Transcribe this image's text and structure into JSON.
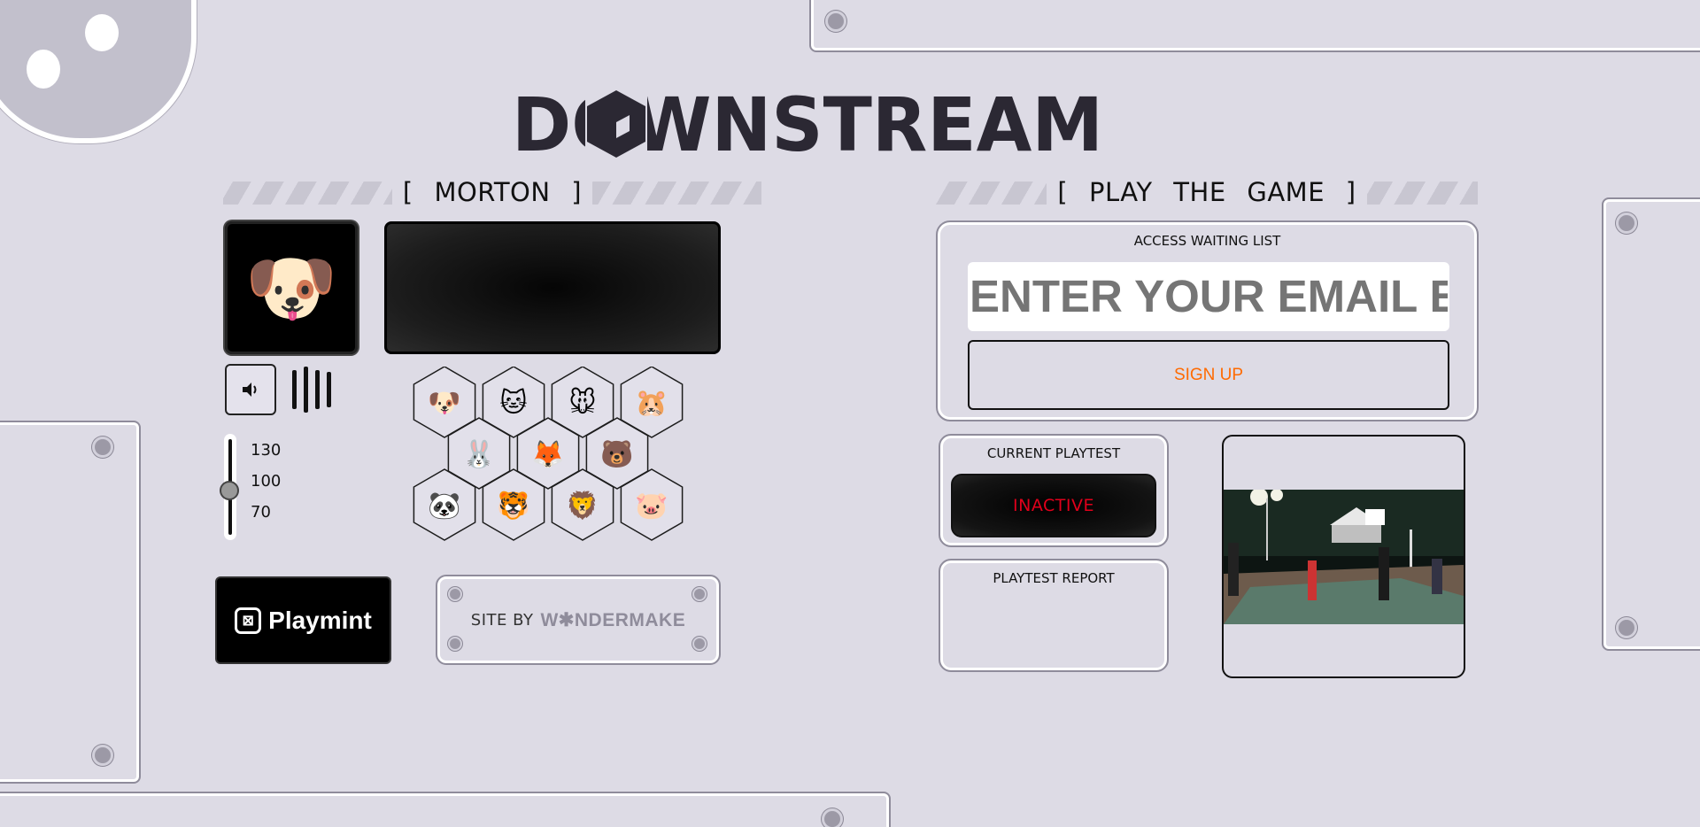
{
  "brand": {
    "logo_text": "DOWNSTREAM"
  },
  "player_section": {
    "title_open": "[",
    "title": "MORTON",
    "title_close": "]",
    "avatar_emoji": "🐶",
    "volume": {
      "labels": [
        "130",
        "100",
        "70"
      ],
      "current": 100
    },
    "animal_picker": {
      "rows": [
        [
          "🐶",
          "🐱",
          "🐭",
          "🐹"
        ],
        [
          "🐰",
          "🦊",
          "🐻"
        ],
        [
          "🐼",
          "🐯",
          "🦁",
          "🐷"
        ]
      ]
    }
  },
  "sponsor": {
    "name": "Playmint"
  },
  "credits": {
    "prefix": "SITE BY",
    "studio": "W✱NDERMAKE"
  },
  "game_section": {
    "title_open": "[",
    "title": "PLAY THE GAME",
    "title_close": "]",
    "waitlist": {
      "title": "ACCESS WAITING LIST",
      "email_placeholder": "ENTER YOUR EMAIL ENTER",
      "signup_label": "SIGN UP"
    },
    "playtest": {
      "title": "CURRENT PLAYTEST",
      "status": "INACTIVE"
    },
    "report": {
      "title": "PLAYTEST REPORT"
    }
  },
  "colors": {
    "background": "#dddbe5",
    "accent_orange": "#ff6a00",
    "status_red": "#e0001b",
    "logo_dark": "#2b2833"
  }
}
